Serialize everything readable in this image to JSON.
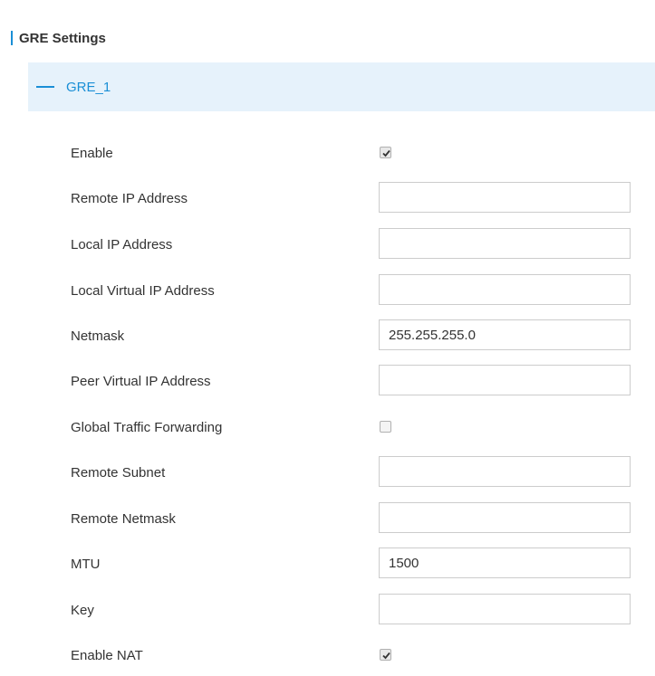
{
  "section": {
    "title": "GRE Settings"
  },
  "panel": {
    "title": "GRE_1"
  },
  "fields": [
    {
      "label": "Enable",
      "type": "checkbox",
      "checked": true
    },
    {
      "label": "Remote IP Address",
      "type": "text",
      "value": ""
    },
    {
      "label": "Local IP Address",
      "type": "text",
      "value": ""
    },
    {
      "label": "Local Virtual IP Address",
      "type": "text",
      "value": ""
    },
    {
      "label": "Netmask",
      "type": "text",
      "value": "255.255.255.0"
    },
    {
      "label": "Peer Virtual IP Address",
      "type": "text",
      "value": ""
    },
    {
      "label": "Global Traffic Forwarding",
      "type": "checkbox",
      "checked": false
    },
    {
      "label": "Remote Subnet",
      "type": "text",
      "value": ""
    },
    {
      "label": "Remote Netmask",
      "type": "text",
      "value": ""
    },
    {
      "label": "MTU",
      "type": "text",
      "value": "1500"
    },
    {
      "label": "Key",
      "type": "text",
      "value": ""
    },
    {
      "label": "Enable NAT",
      "type": "checkbox",
      "checked": true
    }
  ],
  "colors": {
    "accent": "#1a8fd6",
    "header_bg": "#e6f2fb",
    "border": "#cccccc"
  },
  "icons": {
    "collapse": "minus-icon",
    "check": "checkmark-icon"
  }
}
